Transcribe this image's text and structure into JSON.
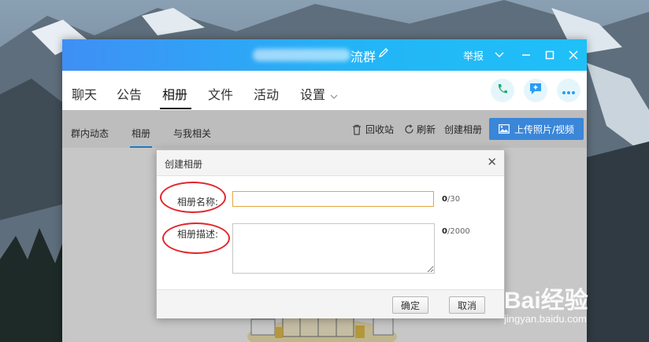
{
  "window": {
    "title": "流群",
    "report_label": "举报"
  },
  "nav": {
    "tabs": [
      "聊天",
      "公告",
      "相册",
      "文件",
      "活动",
      "设置"
    ],
    "active": "相册"
  },
  "subnav": {
    "tabs": [
      "群内动态",
      "相册",
      "与我相关"
    ],
    "active": "相册",
    "recycle_label": "回收站",
    "refresh_label": "刷新",
    "create_label": "创建相册",
    "upload_label": "上传照片/视频"
  },
  "dialog": {
    "title": "创建相册",
    "close_glyph": "✕",
    "name_label": "相册名称:",
    "name_value": "",
    "name_count": "0",
    "name_max": "/30",
    "desc_label": "相册描述:",
    "desc_value": "",
    "desc_count": "0",
    "desc_max": "/2000",
    "ok_label": "确定",
    "cancel_label": "取消"
  },
  "watermark": {
    "brand": "Bai经验",
    "url": "jingyan.baidu.com"
  },
  "colors": {
    "titlebar_start": "#3f8ff5",
    "titlebar_end": "#1fc0f8",
    "upload_button": "#3a86d8",
    "annotation_red": "#e2262b",
    "input_focus": "#e3a73c"
  },
  "icons": [
    "edit-icon",
    "chevron-down-icon",
    "minimize-icon",
    "maximize-icon",
    "close-icon",
    "phone-icon",
    "message-icon",
    "more-icon",
    "trash-icon",
    "refresh-icon",
    "image-icon"
  ]
}
